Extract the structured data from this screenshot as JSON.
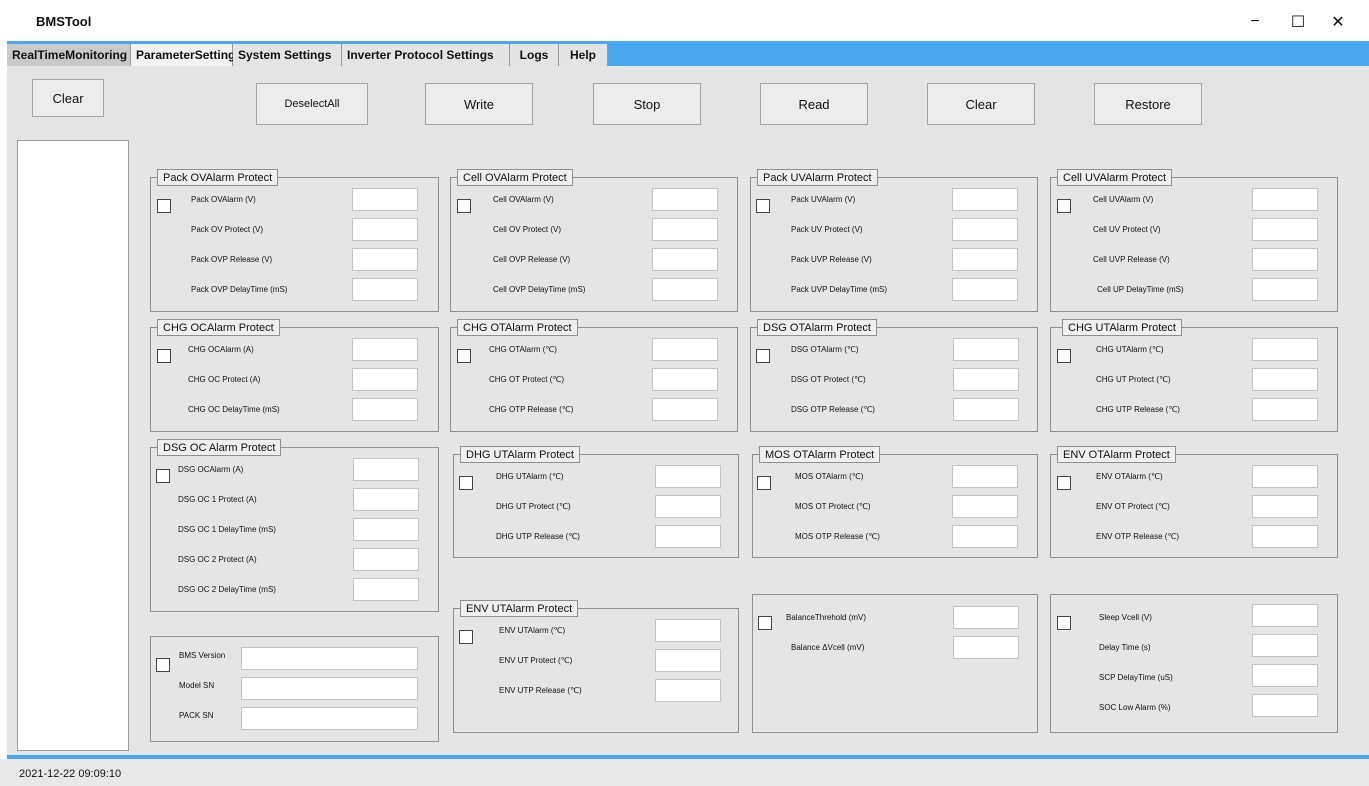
{
  "app": {
    "title": "BMSTool"
  },
  "window_controls": {
    "minimize": "−",
    "maximize": "☐",
    "close": "✕"
  },
  "tabs": [
    "RealTimeMonitoring",
    "ParameterSetting",
    "System Settings",
    "Inverter Protocol Settings",
    "Logs",
    "Help"
  ],
  "toolbar": {
    "left_clear": "Clear",
    "deselect_all": "DeselectAll",
    "write": "Write",
    "stop": "Stop",
    "read": "Read",
    "clear": "Clear",
    "restore": "Restore"
  },
  "groups": {
    "pack_ov": {
      "title": "Pack OVAlarm Protect",
      "rows": [
        "Pack OVAlarm (V)",
        "Pack OV Protect (V)",
        "Pack OVP Release (V)",
        "Pack OVP DelayTime (mS)"
      ]
    },
    "cell_ov": {
      "title": "Cell OVAlarm Protect",
      "rows": [
        "Cell OVAlarm (V)",
        "Cell OV Protect (V)",
        "Cell OVP Release (V)",
        "Cell OVP DelayTime (mS)"
      ]
    },
    "pack_uv": {
      "title": "Pack UVAlarm Protect",
      "rows": [
        "Pack UVAlarm (V)",
        "Pack UV Protect (V)",
        "Pack UVP Release (V)",
        "Pack UVP DelayTime (mS)"
      ]
    },
    "cell_uv": {
      "title": "Cell UVAlarm Protect",
      "rows": [
        "Cell UVAlarm (V)",
        "Cell UV Protect (V)",
        "Cell UVP Release (V)",
        "Cell UP DelayTime (mS)"
      ]
    },
    "chg_oc": {
      "title": "CHG OCAlarm Protect",
      "rows": [
        "CHG OCAlarm (A)",
        "CHG OC Protect (A)",
        "CHG OC DelayTime (mS)"
      ]
    },
    "chg_ot": {
      "title": "CHG OTAlarm Protect",
      "rows": [
        "CHG OTAlarm (℃)",
        "CHG OT Protect (℃)",
        "CHG OTP Release (℃)"
      ]
    },
    "dsg_ot": {
      "title": "DSG OTAlarm Protect",
      "rows": [
        "DSG OTAlarm (℃)",
        "DSG OT Protect (℃)",
        "DSG OTP Release (℃)"
      ]
    },
    "chg_ut": {
      "title": "CHG UTAlarm Protect",
      "rows": [
        "CHG UTAlarm (℃)",
        "CHG UT Protect (℃)",
        "CHG UTP Release (℃)"
      ]
    },
    "dsg_oc": {
      "title": "DSG OC Alarm Protect",
      "rows": [
        "DSG OCAlarm (A)",
        "DSG OC 1 Protect (A)",
        "DSG OC 1 DelayTime (mS)",
        "DSG OC 2 Protect (A)",
        "DSG OC 2 DelayTime (mS)"
      ]
    },
    "dhg_ut": {
      "title": "DHG UTAlarm Protect",
      "rows": [
        "DHG UTAlarm (℃)",
        "DHG UT Protect (℃)",
        "DHG UTP Release (℃)"
      ]
    },
    "mos_ot": {
      "title": "MOS OTAlarm Protect",
      "rows": [
        "MOS OTAlarm (℃)",
        "MOS OT Protect (℃)",
        "MOS OTP Release (℃)"
      ]
    },
    "env_ot": {
      "title": "ENV OTAlarm Protect",
      "rows": [
        "ENV OTAlarm (℃)",
        "ENV OT Protect (℃)",
        "ENV OTP Release (℃)"
      ]
    },
    "env_ut": {
      "title": "ENV UTAlarm Protect",
      "rows": [
        "ENV UTAlarm (℃)",
        "ENV UT Protect (℃)",
        "ENV UTP Release (℃)"
      ]
    },
    "balance": {
      "rows": [
        "BalanceThrehold (mV)",
        "Balance ΔVcell (mV)"
      ]
    },
    "sleep": {
      "rows": [
        "Sleep Vcell  (V)",
        "Delay Time  (s)",
        "SCP DelayTime  (uS)",
        "SOC Low Alarm (%)"
      ]
    },
    "version": {
      "rows": [
        "BMS Version",
        "Model SN",
        "PACK SN"
      ]
    }
  },
  "status": {
    "timestamp": "2021-12-22 09:09:10"
  }
}
